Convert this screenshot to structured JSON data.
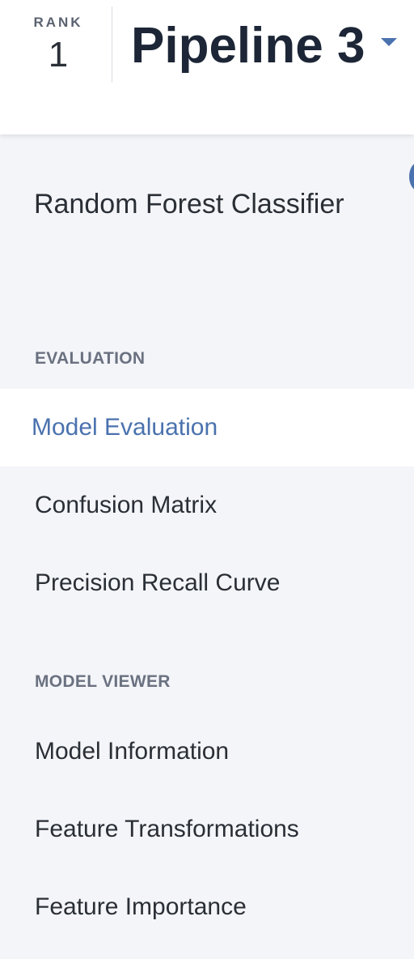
{
  "header": {
    "rank_label": "RANK",
    "rank_value": "1",
    "pipeline_title": "Pipeline 3"
  },
  "sidebar": {
    "model_name": "Random Forest Classifier",
    "sections": [
      {
        "label": "EVALUATION",
        "items": [
          {
            "label": "Model Evaluation",
            "active": true
          },
          {
            "label": "Confusion Matrix",
            "active": false
          },
          {
            "label": "Precision Recall Curve",
            "active": false
          }
        ]
      },
      {
        "label": "MODEL VIEWER",
        "items": [
          {
            "label": "Model Information",
            "active": false
          },
          {
            "label": "Feature Transformations",
            "active": false
          },
          {
            "label": "Feature Importance",
            "active": false
          }
        ]
      }
    ]
  },
  "colors": {
    "accent": "#4a72ae",
    "title": "#1c2636",
    "text": "#2a2f36",
    "section_label": "#6a7180",
    "sidebar_bg": "#f4f5f9",
    "active_bg": "#ffffff"
  }
}
